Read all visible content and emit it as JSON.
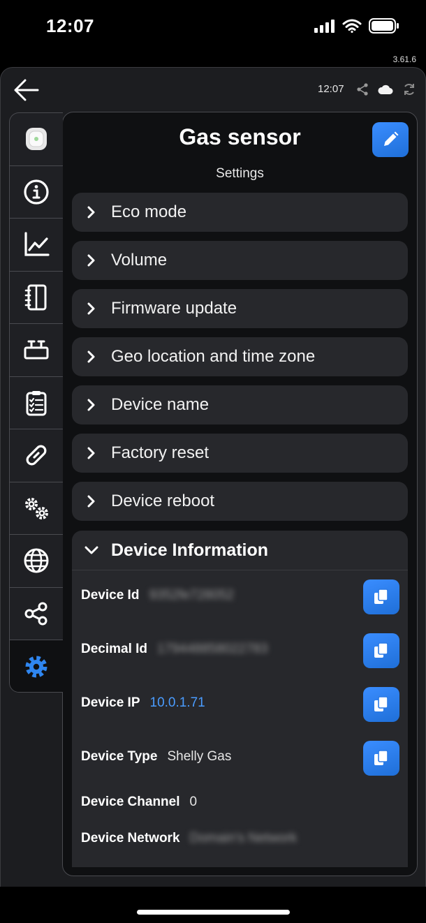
{
  "status_bar": {
    "time": "12:07"
  },
  "version": "3.61.6",
  "top_bar": {
    "time": "12:07"
  },
  "header": {
    "title": "Gas sensor",
    "subtitle": "Settings"
  },
  "sections": [
    {
      "label": "Eco mode"
    },
    {
      "label": "Volume"
    },
    {
      "label": "Firmware update"
    },
    {
      "label": "Geo location and time zone"
    },
    {
      "label": "Device name"
    },
    {
      "label": "Factory reset"
    },
    {
      "label": "Device reboot"
    }
  ],
  "device_info": {
    "title": "Device Information",
    "rows": [
      {
        "key": "Device Id",
        "value": "9352fe728052"
      },
      {
        "key": "Decimal Id",
        "value": "179448858022783"
      },
      {
        "key": "Device IP",
        "value": "10.0.1.71"
      },
      {
        "key": "Device Type",
        "value": "Shelly Gas"
      },
      {
        "key": "Device Channel",
        "value": "0"
      },
      {
        "key": "Device Network",
        "value": "Domain's Network"
      }
    ]
  },
  "colors": {
    "accent": "#2f80ed",
    "link": "#4a9cff",
    "card": "#27282c",
    "background": "#0f1012"
  },
  "icons": [
    "back-arrow-icon",
    "share-icon",
    "cloud-icon",
    "refresh-icon",
    "device-icon",
    "info-icon",
    "chart-icon",
    "notebook-icon",
    "scenes-icon",
    "checklist-icon",
    "link-icon",
    "gears-icon",
    "globe-icon",
    "share-nodes-icon",
    "settings-gear-icon",
    "pencil-icon",
    "copy-icon"
  ]
}
